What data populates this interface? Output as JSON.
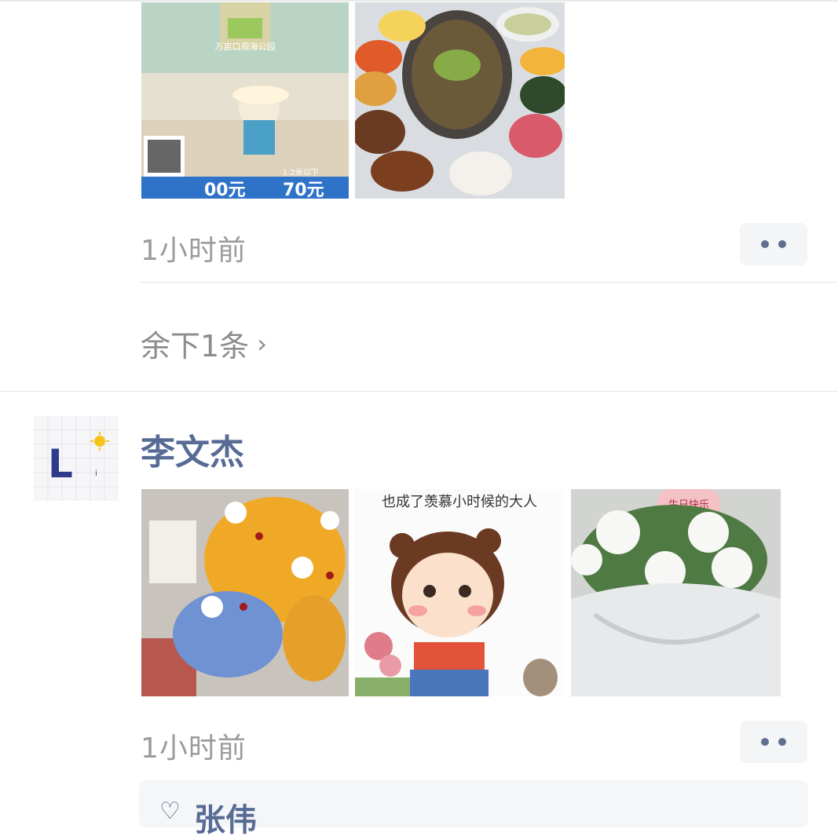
{
  "post1": {
    "images": [
      {
        "icon": "beach-park-ad-image",
        "caption": "万亩口观海公园",
        "price_tag_left": "00元",
        "price_tag_right": "70元",
        "height_note": "1.2米以下"
      },
      {
        "icon": "food-platter-image"
      }
    ],
    "time": "1小时前",
    "more_icon": "more-dots-icon"
  },
  "remaining": {
    "label": "余下1条",
    "chevron_icon": "chevron-right-icon",
    "chevron": "›"
  },
  "post2": {
    "username": "李文杰",
    "avatar": {
      "icon": "avatar-letter-l-icon",
      "letter": "L",
      "small": "i"
    },
    "images": [
      {
        "icon": "flower-bouquet-image"
      },
      {
        "icon": "cartoon-girl-image",
        "caption": "也成了羡慕小时候的大人"
      },
      {
        "icon": "white-roses-image",
        "caption": "生日快乐"
      }
    ],
    "time": "1小时前",
    "more_icon": "more-dots-icon",
    "likes": {
      "heart_icon": "heart-icon",
      "heart": "♡",
      "liker": "张伟"
    }
  },
  "colors": {
    "name_blue": "#576b95",
    "time_gray": "#9b9b9b",
    "button_bg": "#f4f5f7",
    "divider": "#e5e5e5"
  }
}
